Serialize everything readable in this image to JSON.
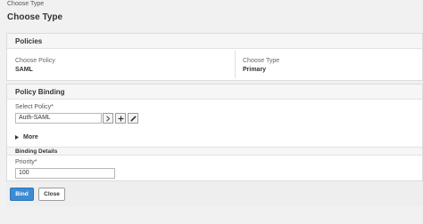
{
  "breadcrumb": "Choose Type",
  "page_title": "Choose Type",
  "policies": {
    "header": "Policies",
    "choose_policy_label": "Choose Policy",
    "choose_policy_value": "SAML",
    "choose_type_label": "Choose Type",
    "choose_type_value": "Primary"
  },
  "policy_binding": {
    "header": "Policy Binding",
    "select_policy_label": "Select Policy*",
    "select_policy_value": "Auth-SAML",
    "more_label": "More",
    "binding_details_header": "Binding Details",
    "priority_label": "Priority*",
    "priority_value": "100"
  },
  "actions": {
    "bind_label": "Bind",
    "close_label": "Close"
  },
  "colors": {
    "primary_button": "#3d8bd3"
  }
}
